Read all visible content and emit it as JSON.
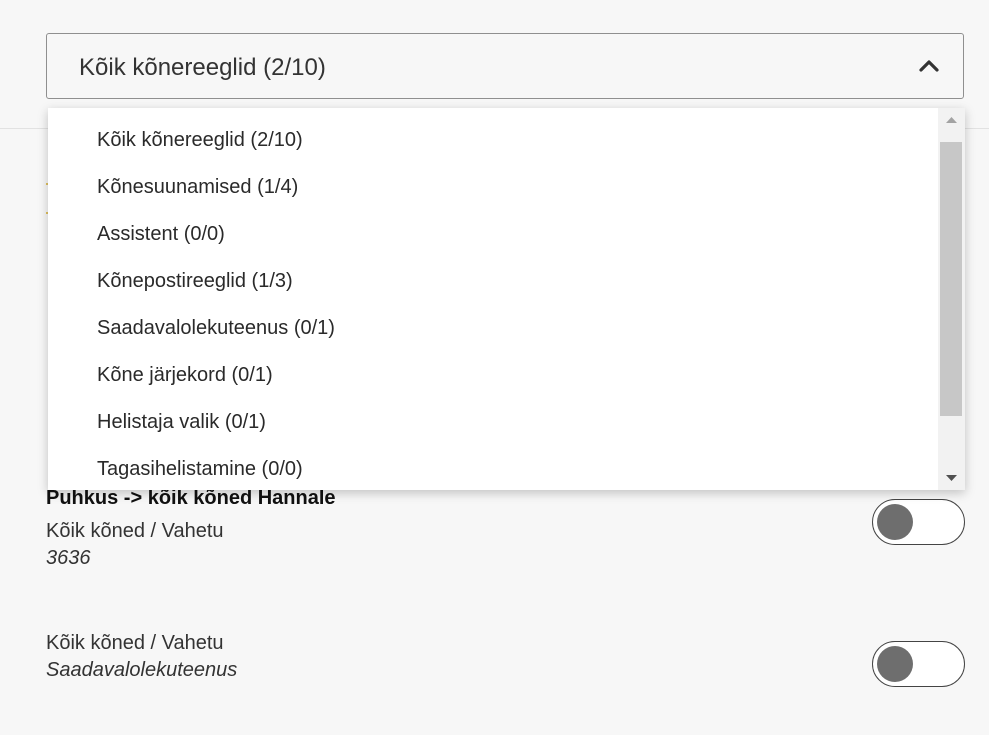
{
  "filter_select": {
    "selected": "Kõik kõnereeglid (2/10)",
    "expanded": true,
    "options": [
      "Kõik kõnereeglid (2/10)",
      "Kõnesuunamised (1/4)",
      "Assistent (0/0)",
      "Kõnepostireeglid (1/3)",
      "Saadavalolekuteenus (0/1)",
      "Kõne järjekord (0/1)",
      "Helistaja valik (0/1)",
      "Tagasihelistamine (0/0)"
    ]
  },
  "rules": [
    {
      "title": "Puhkus -> kõik kõned Hannale",
      "line1": "Kõik kõned / Vahetu",
      "line2": "3636",
      "enabled": false
    },
    {
      "title": "",
      "line1": "Kõik kõned / Vahetu",
      "line2": "Saadavalolekuteenus",
      "enabled": false
    }
  ],
  "colors": {
    "background": "#f7f7f7",
    "dropdown_bg": "#ffffff",
    "scroll_thumb": "#c7c7c7",
    "toggle_knob": "#6e6e6e"
  },
  "icons": {
    "select_toggle": "chevron-up-icon",
    "scroll_up": "scroll-up-arrow-icon",
    "scroll_down": "scroll-down-arrow-icon"
  }
}
